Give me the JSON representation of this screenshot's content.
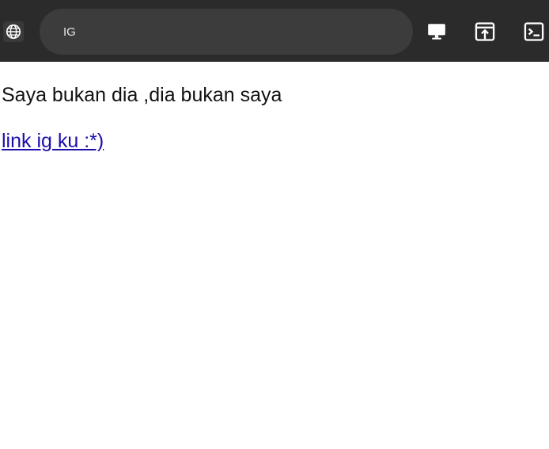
{
  "toolbar": {
    "address_text": "IG",
    "icons": [
      "globe-icon",
      "desktop-icon",
      "open-in-browser-icon",
      "terminal-icon"
    ]
  },
  "page": {
    "paragraph": "Saya bukan dia ,dia bukan saya",
    "link_text": "link ig ku :*)"
  },
  "colors": {
    "toolbar_bg": "#2b2b2b",
    "urlbar_bg": "#3c3c3c",
    "link": "#1a0dab",
    "text": "#111111"
  }
}
